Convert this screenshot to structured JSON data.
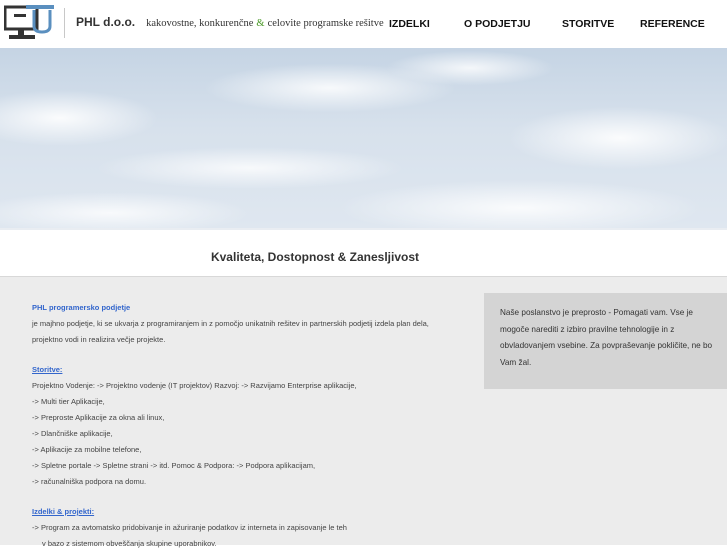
{
  "header": {
    "logo_icon": "phl-logo-icon",
    "company_name": "PHL d.o.o.",
    "tagline_part1": "kakovostne, konkurenčne",
    "tagline_amp": "&",
    "tagline_part2": "celovite programske rešitve"
  },
  "nav": {
    "items": [
      "IZDELKI",
      "O PODJETJU",
      "STORITVE",
      "REFERENCE"
    ]
  },
  "banner": {
    "tagline": "Kvaliteta, Dostopnost & Zanesljivost"
  },
  "main": {
    "intro_heading": "PHL programersko podjetje",
    "intro_line1": "je majhno podjetje, ki se ukvarja z programiranjem in z pomočjo unikatnih rešitev in partnerskih podjetij izdela plan dela,",
    "intro_line2": "projektno vodi in realizira večje projekte.",
    "services_heading": "Storitve:",
    "services": [
      "Projektno Vodenje: -> Projektno vodenje (IT projektov) Razvoj: -> Razvijamo Enterprise aplikacije,",
      "-> Multi tier Aplikacije,",
      "-> Preproste Aplikacije za okna ali linux,",
      "-> Dlančniške aplikacije,",
      "-> Aplikacije za mobilne telefone,",
      "-> Spletne portale -> Spletne strani -> itd. Pomoc & Podpora: -> Podpora aplikacijam,",
      "-> računalniška podpora na domu."
    ],
    "products_heading": "Izdelki & projekti:",
    "products": [
      "-> Program za avtomatsko pridobivanje in ažuriranje podatkov iz interneta in zapisovanje le teh",
      "v bazo z sistemom obveščanja skupine uporabnikov."
    ]
  },
  "sidebar": {
    "box_text": "Naše poslanstvo je preprosto - Pomagati vam. Vse je mogoče narediti z izbiro pravilne tehnologije in z obvladovanjem vsebine. Za povpraševanje pokličite, ne bo Vam žal."
  },
  "colors": {
    "accent_blue": "#3366cc",
    "amp_green": "#4c9a2a",
    "content_bg": "#ececec",
    "box_bg": "#d4d4d4"
  }
}
